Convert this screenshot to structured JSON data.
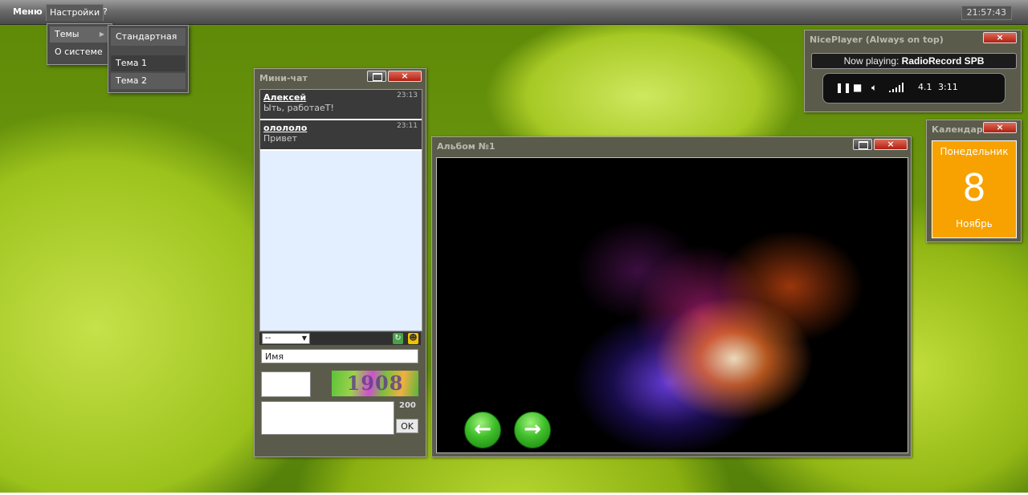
{
  "menubar": {
    "menu_label": "Меню",
    "settings_label": "Настройки",
    "help_label": "?",
    "clock": "21:57:43"
  },
  "settings_menu": {
    "themes_label": "Темы",
    "about_label": "О системе"
  },
  "themes_menu": {
    "items": [
      "Стандартная",
      "Тема 1",
      "Тема 2"
    ]
  },
  "minichat": {
    "title": "Мини-чат",
    "messages": [
      {
        "name": "Алексей",
        "text": "Ыть, работаеТ!",
        "time": "23:13"
      },
      {
        "name": "олололо",
        "text": "Привет",
        "time": "23:11"
      }
    ],
    "select_value": "--",
    "name_field_value": "Имя",
    "captcha_text": "1908",
    "char_limit": "200",
    "ok_label": "OK"
  },
  "album": {
    "title": "Альбом №1",
    "prev_glyph": "←",
    "next_glyph": "→"
  },
  "player": {
    "title": "NicePlayer (Always on top)",
    "now_playing_prefix": "Now playing: ",
    "station": "RadioRecord SPB",
    "version": "4.1",
    "duration": "3:11"
  },
  "calendar": {
    "title": "Календарь",
    "weekday": "Понедельник",
    "day": "8",
    "month": "Ноябрь"
  },
  "colors": {
    "calendar_card": "#f7a200",
    "close_button": "#c0392b",
    "chat_bg": "#e3efff"
  },
  "icons": {
    "window_close": "x-icon",
    "window_maximize": "window-icon",
    "submenu": "chevron-right-icon",
    "refresh": "refresh-icon",
    "smiley": "smiley-icon",
    "play_pause": "pause-icon",
    "stop": "stop-icon",
    "volume": "speaker-icon",
    "signal": "signal-bars-icon",
    "prev": "arrow-left-icon",
    "next": "arrow-right-icon"
  }
}
